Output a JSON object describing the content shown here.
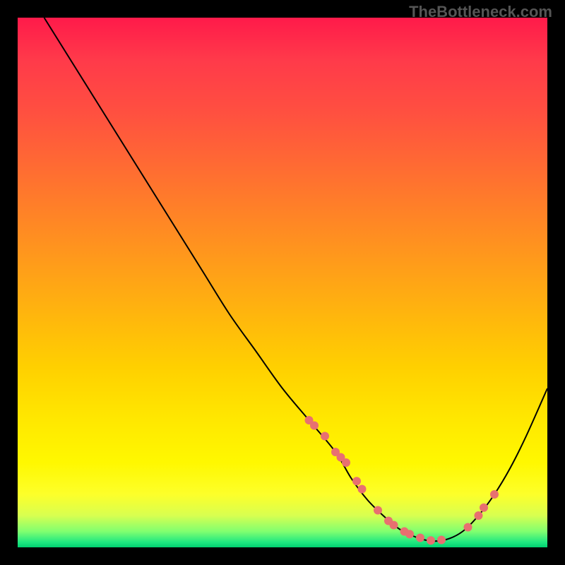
{
  "watermark": "TheBottleneck.com",
  "chart_data": {
    "type": "line",
    "title": "",
    "xlabel": "",
    "ylabel": "",
    "xlim": [
      0,
      100
    ],
    "ylim": [
      0,
      100
    ],
    "series": [
      {
        "name": "bottleneck-curve",
        "x": [
          5,
          10,
          15,
          20,
          25,
          30,
          35,
          40,
          45,
          50,
          55,
          60,
          63,
          66,
          69,
          72,
          75,
          78,
          81,
          84,
          87,
          90,
          93,
          96,
          100
        ],
        "y": [
          100,
          92,
          84,
          76,
          68,
          60,
          52,
          44,
          37,
          30,
          24,
          18,
          13,
          9,
          6,
          3.5,
          2,
          1.2,
          1.5,
          3,
          6,
          10,
          15,
          21,
          30
        ]
      }
    ],
    "scatter_points": {
      "name": "highlighted-points",
      "x": [
        55,
        56,
        58,
        60,
        61,
        62,
        64,
        65,
        68,
        70,
        71,
        73,
        74,
        76,
        78,
        80,
        85,
        87,
        88,
        90
      ],
      "y": [
        24,
        23,
        21,
        18,
        17,
        16,
        12.5,
        11,
        7,
        5,
        4.2,
        3,
        2.5,
        1.8,
        1.3,
        1.4,
        3.8,
        6,
        7.5,
        10
      ]
    },
    "gradient_colors": {
      "top": "#ff1a4a",
      "upper_mid": "#ff9020",
      "lower_mid": "#fff800",
      "bottom": "#00d070"
    }
  }
}
